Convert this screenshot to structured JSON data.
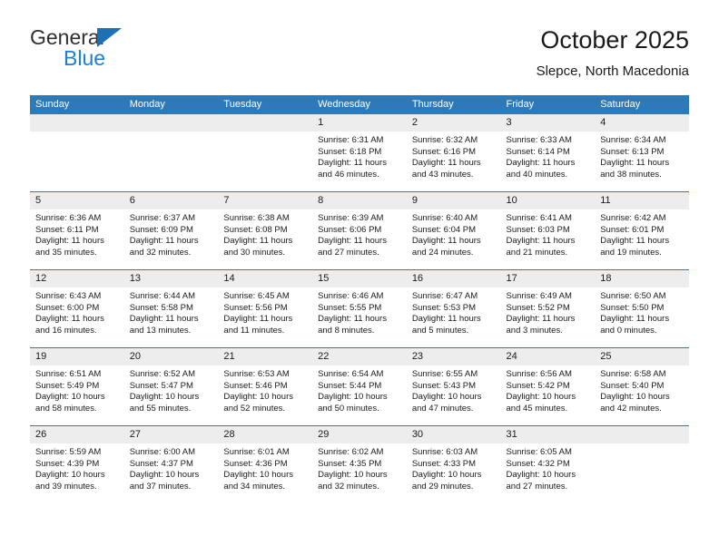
{
  "brand": {
    "name_top": "General",
    "name_bottom": "Blue",
    "triangle_color": "#1f6fb4",
    "text_color": "#1b7fd4"
  },
  "header": {
    "title": "October 2025",
    "subtitle": "Slepce, North Macedonia"
  },
  "colors": {
    "header_blue": "#2e7ab8",
    "daynum_gray": "#ededed",
    "text": "#1a1a1a"
  },
  "weekday_headers": [
    "Sunday",
    "Monday",
    "Tuesday",
    "Wednesday",
    "Thursday",
    "Friday",
    "Saturday"
  ],
  "labels": {
    "sunrise_prefix": "Sunrise:",
    "sunset_prefix": "Sunset:",
    "daylight_prefix": "Daylight:"
  },
  "weeks": [
    [
      {
        "day": "",
        "sunrise": "",
        "sunset": "",
        "daylight_line1": "",
        "daylight_line2": ""
      },
      {
        "day": "",
        "sunrise": "",
        "sunset": "",
        "daylight_line1": "",
        "daylight_line2": ""
      },
      {
        "day": "",
        "sunrise": "",
        "sunset": "",
        "daylight_line1": "",
        "daylight_line2": ""
      },
      {
        "day": "1",
        "sunrise": "Sunrise: 6:31 AM",
        "sunset": "Sunset: 6:18 PM",
        "daylight_line1": "Daylight: 11 hours",
        "daylight_line2": "and 46 minutes."
      },
      {
        "day": "2",
        "sunrise": "Sunrise: 6:32 AM",
        "sunset": "Sunset: 6:16 PM",
        "daylight_line1": "Daylight: 11 hours",
        "daylight_line2": "and 43 minutes."
      },
      {
        "day": "3",
        "sunrise": "Sunrise: 6:33 AM",
        "sunset": "Sunset: 6:14 PM",
        "daylight_line1": "Daylight: 11 hours",
        "daylight_line2": "and 40 minutes."
      },
      {
        "day": "4",
        "sunrise": "Sunrise: 6:34 AM",
        "sunset": "Sunset: 6:13 PM",
        "daylight_line1": "Daylight: 11 hours",
        "daylight_line2": "and 38 minutes."
      }
    ],
    [
      {
        "day": "5",
        "sunrise": "Sunrise: 6:36 AM",
        "sunset": "Sunset: 6:11 PM",
        "daylight_line1": "Daylight: 11 hours",
        "daylight_line2": "and 35 minutes."
      },
      {
        "day": "6",
        "sunrise": "Sunrise: 6:37 AM",
        "sunset": "Sunset: 6:09 PM",
        "daylight_line1": "Daylight: 11 hours",
        "daylight_line2": "and 32 minutes."
      },
      {
        "day": "7",
        "sunrise": "Sunrise: 6:38 AM",
        "sunset": "Sunset: 6:08 PM",
        "daylight_line1": "Daylight: 11 hours",
        "daylight_line2": "and 30 minutes."
      },
      {
        "day": "8",
        "sunrise": "Sunrise: 6:39 AM",
        "sunset": "Sunset: 6:06 PM",
        "daylight_line1": "Daylight: 11 hours",
        "daylight_line2": "and 27 minutes."
      },
      {
        "day": "9",
        "sunrise": "Sunrise: 6:40 AM",
        "sunset": "Sunset: 6:04 PM",
        "daylight_line1": "Daylight: 11 hours",
        "daylight_line2": "and 24 minutes."
      },
      {
        "day": "10",
        "sunrise": "Sunrise: 6:41 AM",
        "sunset": "Sunset: 6:03 PM",
        "daylight_line1": "Daylight: 11 hours",
        "daylight_line2": "and 21 minutes."
      },
      {
        "day": "11",
        "sunrise": "Sunrise: 6:42 AM",
        "sunset": "Sunset: 6:01 PM",
        "daylight_line1": "Daylight: 11 hours",
        "daylight_line2": "and 19 minutes."
      }
    ],
    [
      {
        "day": "12",
        "sunrise": "Sunrise: 6:43 AM",
        "sunset": "Sunset: 6:00 PM",
        "daylight_line1": "Daylight: 11 hours",
        "daylight_line2": "and 16 minutes."
      },
      {
        "day": "13",
        "sunrise": "Sunrise: 6:44 AM",
        "sunset": "Sunset: 5:58 PM",
        "daylight_line1": "Daylight: 11 hours",
        "daylight_line2": "and 13 minutes."
      },
      {
        "day": "14",
        "sunrise": "Sunrise: 6:45 AM",
        "sunset": "Sunset: 5:56 PM",
        "daylight_line1": "Daylight: 11 hours",
        "daylight_line2": "and 11 minutes."
      },
      {
        "day": "15",
        "sunrise": "Sunrise: 6:46 AM",
        "sunset": "Sunset: 5:55 PM",
        "daylight_line1": "Daylight: 11 hours",
        "daylight_line2": "and 8 minutes."
      },
      {
        "day": "16",
        "sunrise": "Sunrise: 6:47 AM",
        "sunset": "Sunset: 5:53 PM",
        "daylight_line1": "Daylight: 11 hours",
        "daylight_line2": "and 5 minutes."
      },
      {
        "day": "17",
        "sunrise": "Sunrise: 6:49 AM",
        "sunset": "Sunset: 5:52 PM",
        "daylight_line1": "Daylight: 11 hours",
        "daylight_line2": "and 3 minutes."
      },
      {
        "day": "18",
        "sunrise": "Sunrise: 6:50 AM",
        "sunset": "Sunset: 5:50 PM",
        "daylight_line1": "Daylight: 11 hours",
        "daylight_line2": "and 0 minutes."
      }
    ],
    [
      {
        "day": "19",
        "sunrise": "Sunrise: 6:51 AM",
        "sunset": "Sunset: 5:49 PM",
        "daylight_line1": "Daylight: 10 hours",
        "daylight_line2": "and 58 minutes."
      },
      {
        "day": "20",
        "sunrise": "Sunrise: 6:52 AM",
        "sunset": "Sunset: 5:47 PM",
        "daylight_line1": "Daylight: 10 hours",
        "daylight_line2": "and 55 minutes."
      },
      {
        "day": "21",
        "sunrise": "Sunrise: 6:53 AM",
        "sunset": "Sunset: 5:46 PM",
        "daylight_line1": "Daylight: 10 hours",
        "daylight_line2": "and 52 minutes."
      },
      {
        "day": "22",
        "sunrise": "Sunrise: 6:54 AM",
        "sunset": "Sunset: 5:44 PM",
        "daylight_line1": "Daylight: 10 hours",
        "daylight_line2": "and 50 minutes."
      },
      {
        "day": "23",
        "sunrise": "Sunrise: 6:55 AM",
        "sunset": "Sunset: 5:43 PM",
        "daylight_line1": "Daylight: 10 hours",
        "daylight_line2": "and 47 minutes."
      },
      {
        "day": "24",
        "sunrise": "Sunrise: 6:56 AM",
        "sunset": "Sunset: 5:42 PM",
        "daylight_line1": "Daylight: 10 hours",
        "daylight_line2": "and 45 minutes."
      },
      {
        "day": "25",
        "sunrise": "Sunrise: 6:58 AM",
        "sunset": "Sunset: 5:40 PM",
        "daylight_line1": "Daylight: 10 hours",
        "daylight_line2": "and 42 minutes."
      }
    ],
    [
      {
        "day": "26",
        "sunrise": "Sunrise: 5:59 AM",
        "sunset": "Sunset: 4:39 PM",
        "daylight_line1": "Daylight: 10 hours",
        "daylight_line2": "and 39 minutes."
      },
      {
        "day": "27",
        "sunrise": "Sunrise: 6:00 AM",
        "sunset": "Sunset: 4:37 PM",
        "daylight_line1": "Daylight: 10 hours",
        "daylight_line2": "and 37 minutes."
      },
      {
        "day": "28",
        "sunrise": "Sunrise: 6:01 AM",
        "sunset": "Sunset: 4:36 PM",
        "daylight_line1": "Daylight: 10 hours",
        "daylight_line2": "and 34 minutes."
      },
      {
        "day": "29",
        "sunrise": "Sunrise: 6:02 AM",
        "sunset": "Sunset: 4:35 PM",
        "daylight_line1": "Daylight: 10 hours",
        "daylight_line2": "and 32 minutes."
      },
      {
        "day": "30",
        "sunrise": "Sunrise: 6:03 AM",
        "sunset": "Sunset: 4:33 PM",
        "daylight_line1": "Daylight: 10 hours",
        "daylight_line2": "and 29 minutes."
      },
      {
        "day": "31",
        "sunrise": "Sunrise: 6:05 AM",
        "sunset": "Sunset: 4:32 PM",
        "daylight_line1": "Daylight: 10 hours",
        "daylight_line2": "and 27 minutes."
      },
      {
        "day": "",
        "sunrise": "",
        "sunset": "",
        "daylight_line1": "",
        "daylight_line2": ""
      }
    ]
  ]
}
